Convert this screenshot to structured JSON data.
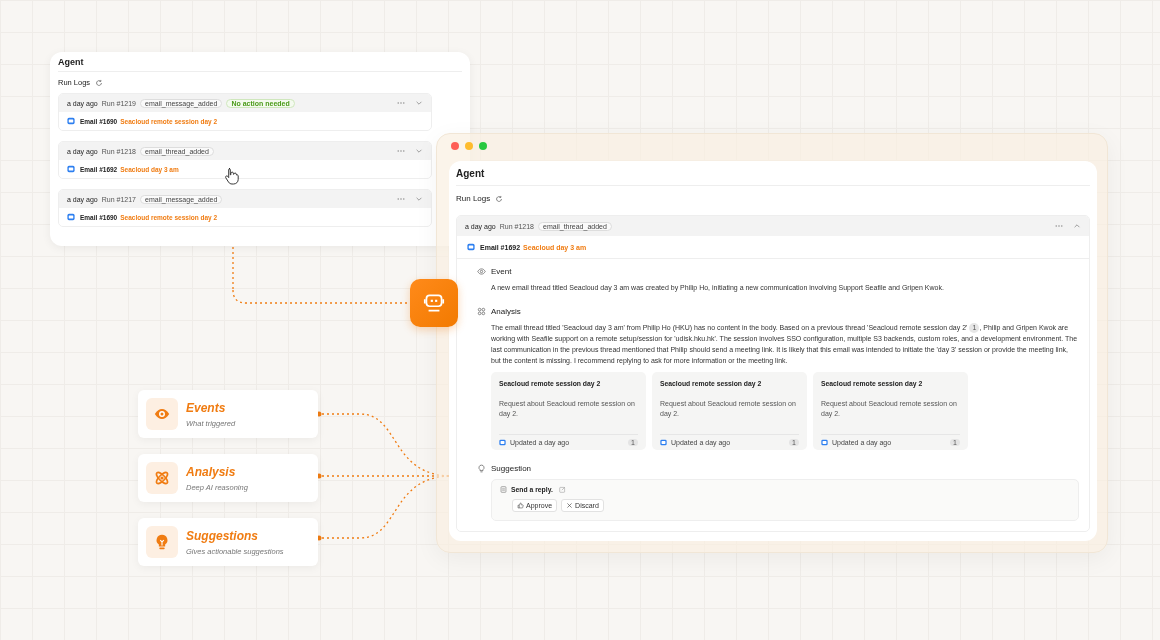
{
  "back_window": {
    "title": "Agent",
    "section": "Run Logs",
    "runs": [
      {
        "time": "a day ago",
        "run": "Run #1219",
        "event": "email_message_added",
        "status": "No action needed",
        "email_label": "Email #1690",
        "email_subject": "Seacloud remote session day 2",
        "expanded": false
      },
      {
        "time": "a day ago",
        "run": "Run #1218",
        "event": "email_thread_added",
        "email_label": "Email #1692",
        "email_subject": "Seacloud day 3 am",
        "expanded": false
      },
      {
        "time": "a day ago",
        "run": "Run #1217",
        "event": "email_message_added",
        "email_label": "Email #1690",
        "email_subject": "Seacloud remote session day 2",
        "expanded": false
      }
    ]
  },
  "front_window": {
    "title": "Agent",
    "section": "Run Logs",
    "run": {
      "time": "a day ago",
      "run": "Run #1218",
      "event": "email_thread_added",
      "email_label": "Email #1692",
      "email_subject": "Seacloud day 3 am",
      "expanded": true
    },
    "event": {
      "heading": "Event",
      "text": "A new email thread titled Seacloud day 3 am was created by Philip Ho, initiating a new communication involving Support Seafile and Gripen Kwok."
    },
    "analysis": {
      "heading": "Analysis",
      "text_before": "The email thread titled 'Seacloud day 3 am' from Philip Ho (HKU) has no content in the body. Based on a previous thread 'Seacloud remote session day 2'",
      "citation": "1",
      "text_after": ", Philip and Gripen Kwok are working with Seafile support on a remote setup/session for 'udisk.hku.hk'. The session involves SSO configuration, multiple S3 backends, custom roles, and a development environment. The last communication in the previous thread mentioned that Philip should send a meeting link. It is likely that this email was intended to initiate the 'day 3' session or provide the meeting link, but the content is missing. I recommend replying to ask for more information or the meeting link.",
      "cards": [
        {
          "title": "Seacloud remote session day 2",
          "description": "Request about Seacloud remote session on day 2.",
          "updated": "Updated a day ago",
          "count": "1"
        },
        {
          "title": "Seacloud remote session day 2",
          "description": "Request about Seacloud remote session on day 2.",
          "updated": "Updated a day ago",
          "count": "1"
        },
        {
          "title": "Seacloud remote session day 2",
          "description": "Request about Seacloud remote session on day 2.",
          "updated": "Updated a day ago",
          "count": "1"
        }
      ]
    },
    "suggestion": {
      "heading": "Suggestion",
      "action": "Send a reply.",
      "buttons": [
        {
          "kind": "approve",
          "label": "Approve"
        },
        {
          "kind": "discard",
          "label": "Discard"
        }
      ]
    }
  },
  "features": [
    {
      "kind": "events",
      "title": "Events",
      "subtitle": "What triggered"
    },
    {
      "kind": "analysis",
      "title": "Analysis",
      "subtitle": "Deep AI reasoning"
    },
    {
      "kind": "suggestions",
      "title": "Suggestions",
      "subtitle": "Gives actionable suggestions"
    }
  ]
}
